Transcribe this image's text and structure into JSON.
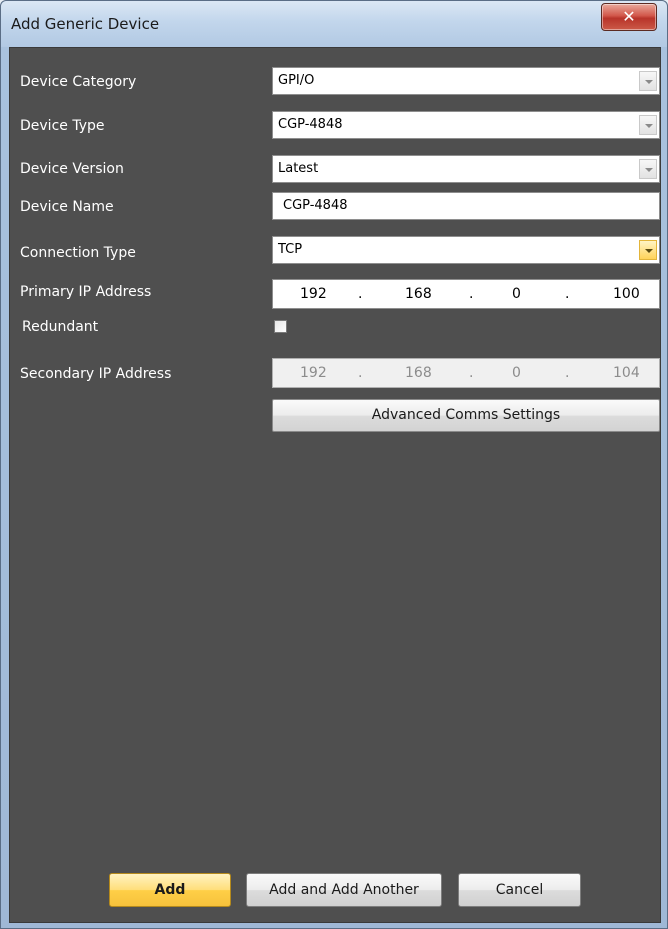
{
  "window": {
    "title": "Add Generic Device",
    "close_glyph": "✕"
  },
  "form": {
    "device_category": {
      "label": "Device Category",
      "value": "GPI/O"
    },
    "device_type": {
      "label": "Device Type",
      "value": "CGP-4848"
    },
    "device_version": {
      "label": "Device Version",
      "value": "Latest"
    },
    "device_name": {
      "label": "Device Name",
      "value": "CGP-4848"
    },
    "connection_type": {
      "label": "Connection Type",
      "value": "TCP"
    },
    "primary_ip": {
      "label": "Primary IP Address",
      "octets": [
        "192",
        "168",
        "0",
        "100"
      ],
      "dot": "."
    },
    "redundant": {
      "label": "Redundant",
      "checked": false
    },
    "secondary_ip": {
      "label": "Secondary IP Address",
      "octets": [
        "192",
        "168",
        "0",
        "104"
      ],
      "dot": "."
    },
    "advanced_button": "Advanced Comms Settings"
  },
  "footer": {
    "add": "Add",
    "add_another": "Add and Add Another",
    "cancel": "Cancel"
  },
  "colors": {
    "panel_bg": "#4f4f4f",
    "accent": "#ffcf47",
    "close_red": "#c8453a"
  }
}
